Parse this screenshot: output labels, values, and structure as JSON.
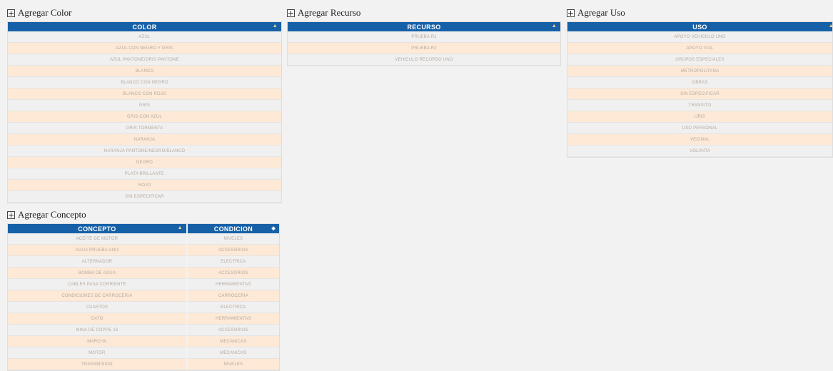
{
  "color": {
    "add_label": "Agregar Color",
    "header": "COLOR",
    "rows": [
      "AZUL",
      "AZUL CON NEGRO Y GRIS",
      "AZUL PANTONE/GRIS PANTONE",
      "BLANCO",
      "BLANCO CON NEGRO",
      "BLANCO CON ROJO",
      "GRIS",
      "GRIS CON AZUL",
      "GRIS TORMENTA",
      "NARANJA",
      "NARANJA PANTONE/NEGRO/BLANCO",
      "NEGRO",
      "PLATA BRILLANTE",
      "ROJO",
      "SIN ESPECIFICAR"
    ]
  },
  "recurso": {
    "add_label": "Agregar Recurso",
    "header": "RECURSO",
    "rows": [
      "PRUEBA R1",
      "PRUEBA R2",
      "VEHICULO RECURSO UNO"
    ]
  },
  "uso": {
    "add_label": "Agregar Uso",
    "header": "USO",
    "rows": [
      "APOYO VEHICULO UNO",
      "APOYO VIAL",
      "GRUPOS ESPECIALES",
      "METROPOLITANA",
      "OBRAS",
      "SIN ESPECIFICAR",
      "TRANSITO",
      "URIS",
      "USO PERSONAL",
      "VECINAL",
      "VOLANTA"
    ]
  },
  "concepto": {
    "add_label": "Agregar Concepto",
    "header_concepto": "CONCEPTO",
    "header_condicion": "CONDICION",
    "rows": [
      [
        "ACEITE DE MOTOR",
        "NIVELES"
      ],
      [
        "AGUA PRUEBA UNO",
        "ACCESORIOS"
      ],
      [
        "ALTERNADOR",
        "ELECTRICA"
      ],
      [
        "BOMBA DE AGUA",
        "ACCESORIOS"
      ],
      [
        "CABLES PASA CORRIENTE",
        "HERRAMIENTAS"
      ],
      [
        "CONDICIONES DE CARROCERIA",
        "CARROCERIA"
      ],
      [
        "CUARTOS",
        "ELECTRICA"
      ],
      [
        "GATO",
        "HERRAMIENTAS"
      ],
      [
        "MINA DE COPPE 18",
        "ACCESORIOS"
      ],
      [
        "MARCHA",
        "MECANICAS"
      ],
      [
        "MOTOR",
        "MECANICAS"
      ],
      [
        "TRANSMISION",
        "NIVELES"
      ]
    ]
  },
  "icons": {
    "sort_asc": "▲",
    "sort_both": "◆"
  }
}
